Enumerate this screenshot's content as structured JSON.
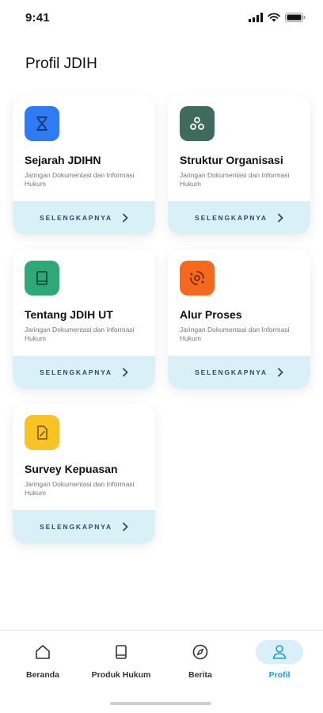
{
  "status_bar": {
    "time": "9:41",
    "icons": [
      "cellular-signal-icon",
      "wifi-icon",
      "battery-icon"
    ]
  },
  "page": {
    "title": "Profil JDIH"
  },
  "cards": [
    {
      "title": "Sejarah JDIHN",
      "description": "Jaringan Dokumentasi dan Informasi Hukum",
      "action": "SELENGKAPNYA",
      "icon": "hourglass-icon",
      "icon_bg": "#2f7bf5"
    },
    {
      "title": "Struktur Organisasi",
      "description": "Jaringan Dokumentasi dan Informasi Hukum",
      "action": "SELENGKAPNYA",
      "icon": "hierarchy-icon",
      "icon_bg": "#3f6b5c"
    },
    {
      "title": "Tentang JDIH UT",
      "description": "Jaringan Dokumentasi dan Informasi Hukum",
      "action": "SELENGKAPNYA",
      "icon": "book-icon",
      "icon_bg": "#2fa878"
    },
    {
      "title": "Alur Proses",
      "description": "Jaringan Dokumentasi dan Informasi Hukum",
      "action": "SELENGKAPNYA",
      "icon": "process-cycle-icon",
      "icon_bg": "#f5691e"
    },
    {
      "title": "Survey Kepuasan",
      "description": "Jaringan Dokumentasi dan Informasi Hukum",
      "action": "SELENGKAPNYA",
      "icon": "note-pencil-icon",
      "icon_bg": "#f7c325"
    }
  ],
  "bottom_nav": {
    "items": [
      {
        "label": "Beranda",
        "icon": "home-icon",
        "active": false
      },
      {
        "label": "Produk Hukum",
        "icon": "book-icon",
        "active": false
      },
      {
        "label": "Berita",
        "icon": "compass-icon",
        "active": false
      },
      {
        "label": "Profil",
        "icon": "user-icon",
        "active": true
      }
    ]
  },
  "colors": {
    "accent": "#1a9fd8",
    "card_footer": "#daf0f7",
    "footer_text": "#2b4a6b"
  }
}
